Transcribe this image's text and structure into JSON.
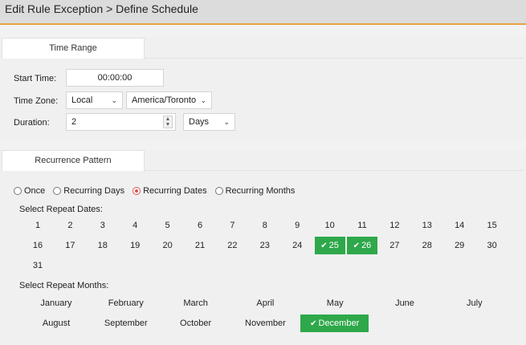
{
  "header": {
    "title": "Edit Rule Exception > Define Schedule"
  },
  "time_range": {
    "tab_label": "Time Range",
    "start_time": {
      "label": "Start Time:",
      "value": "00:00:00"
    },
    "time_zone": {
      "label": "Time Zone:",
      "zone_mode": "Local",
      "zone_name": "America/Toronto"
    },
    "duration": {
      "label": "Duration:",
      "value": "2",
      "unit": "Days"
    }
  },
  "recurrence": {
    "tab_label": "Recurrence Pattern",
    "options": [
      {
        "label": "Once",
        "selected": false
      },
      {
        "label": "Recurring Days",
        "selected": false
      },
      {
        "label": "Recurring Dates",
        "selected": true
      },
      {
        "label": "Recurring Months",
        "selected": false
      }
    ],
    "dates_label": "Select Repeat Dates:",
    "dates": [
      "1",
      "2",
      "3",
      "4",
      "5",
      "6",
      "7",
      "8",
      "9",
      "10",
      "11",
      "12",
      "13",
      "14",
      "15",
      "16",
      "17",
      "18",
      "19",
      "20",
      "21",
      "22",
      "23",
      "24",
      "25",
      "26",
      "27",
      "28",
      "29",
      "30",
      "31"
    ],
    "selected_dates": [
      "25",
      "26"
    ],
    "months_label": "Select Repeat Months:",
    "months": [
      "January",
      "February",
      "March",
      "April",
      "May",
      "June",
      "July",
      "August",
      "September",
      "October",
      "November",
      "December"
    ],
    "selected_months": [
      "December"
    ]
  },
  "colors": {
    "accent": "#e8a33d",
    "selected": "#2ea84a",
    "radio": "#d9534f"
  },
  "icons": {
    "check": "check-icon",
    "caret": "chevron-down-icon",
    "spinner": "spinner-icon"
  }
}
